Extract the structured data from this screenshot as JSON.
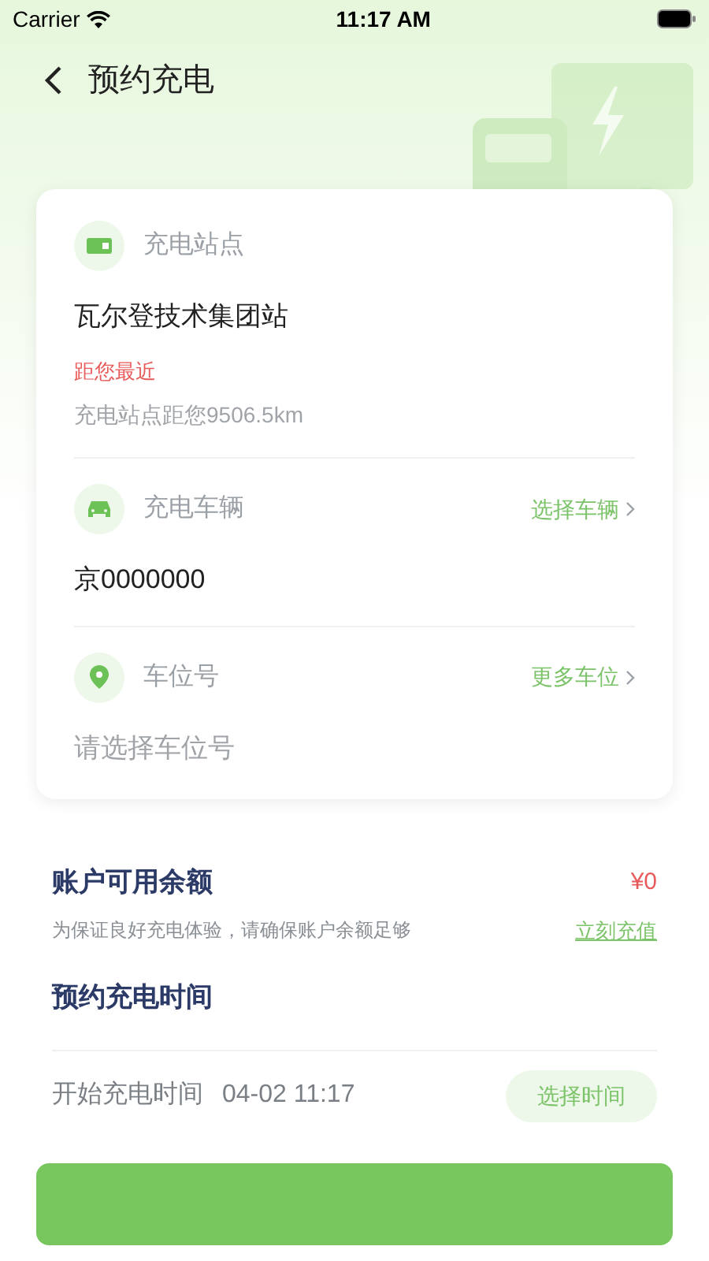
{
  "status_bar": {
    "carrier": "Carrier",
    "time": "11:17 AM"
  },
  "header": {
    "title": "预约充电"
  },
  "station": {
    "label": "充电站点",
    "name": "瓦尔登技术集团站",
    "tag": "距您最近",
    "distance": "充电站点距您9506.5km"
  },
  "vehicle": {
    "label": "充电车辆",
    "action": "选择车辆",
    "value": "京0000000",
    "is_placeholder": false
  },
  "parking": {
    "label": "车位号",
    "action": "更多车位",
    "value": "请选择车位号",
    "is_placeholder": true
  },
  "balance": {
    "title": "账户可用余额",
    "amount": "¥0",
    "note": "为保证良好充电体验，请确保账户余额足够",
    "action": "立刻充值"
  },
  "schedule": {
    "title": "预约充电时间",
    "start_label": "开始充电时间",
    "start_value": "04-02 11:17",
    "action": "选择时间"
  }
}
